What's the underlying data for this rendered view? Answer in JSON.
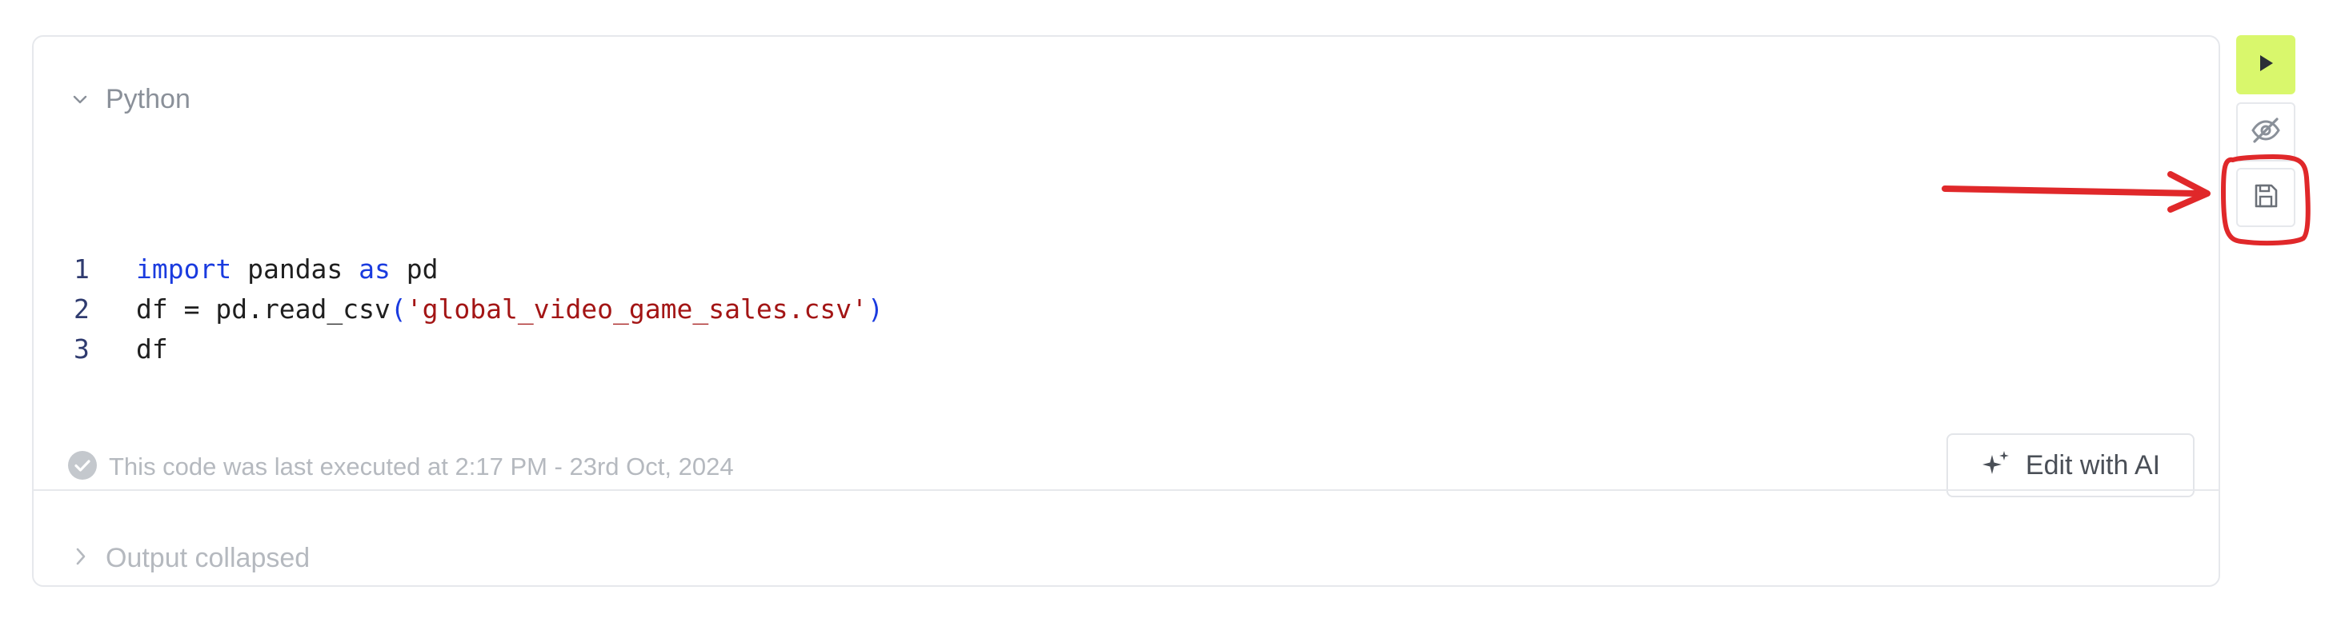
{
  "cell": {
    "language": "Python",
    "code_lines": [
      {
        "number": "1",
        "tokens": [
          {
            "text": "import",
            "type": "keyword"
          },
          {
            "text": " pandas ",
            "type": "default"
          },
          {
            "text": "as",
            "type": "keyword"
          },
          {
            "text": " pd",
            "type": "default"
          }
        ]
      },
      {
        "number": "2",
        "tokens": [
          {
            "text": "df = pd.read_csv",
            "type": "default"
          },
          {
            "text": "(",
            "type": "punct"
          },
          {
            "text": "'global_video_game_sales.csv'",
            "type": "string"
          },
          {
            "text": ")",
            "type": "punct"
          }
        ]
      },
      {
        "number": "3",
        "tokens": [
          {
            "text": "df",
            "type": "default"
          }
        ]
      }
    ],
    "status_text": "This code was last executed at 2:17 PM - 23rd Oct, 2024",
    "edit_ai_label": "Edit with AI",
    "output_label": "Output collapsed"
  },
  "side_toolbar": {
    "buttons": [
      {
        "name": "run-button",
        "icon": "play-icon"
      },
      {
        "name": "hide-button",
        "icon": "eye-off-icon"
      },
      {
        "name": "save-button",
        "icon": "save-icon"
      }
    ]
  },
  "colors": {
    "run_button_bg": "#d9f76c",
    "keyword": "#1a3bdf",
    "string": "#a31515",
    "annotation_red": "#e0282a"
  }
}
